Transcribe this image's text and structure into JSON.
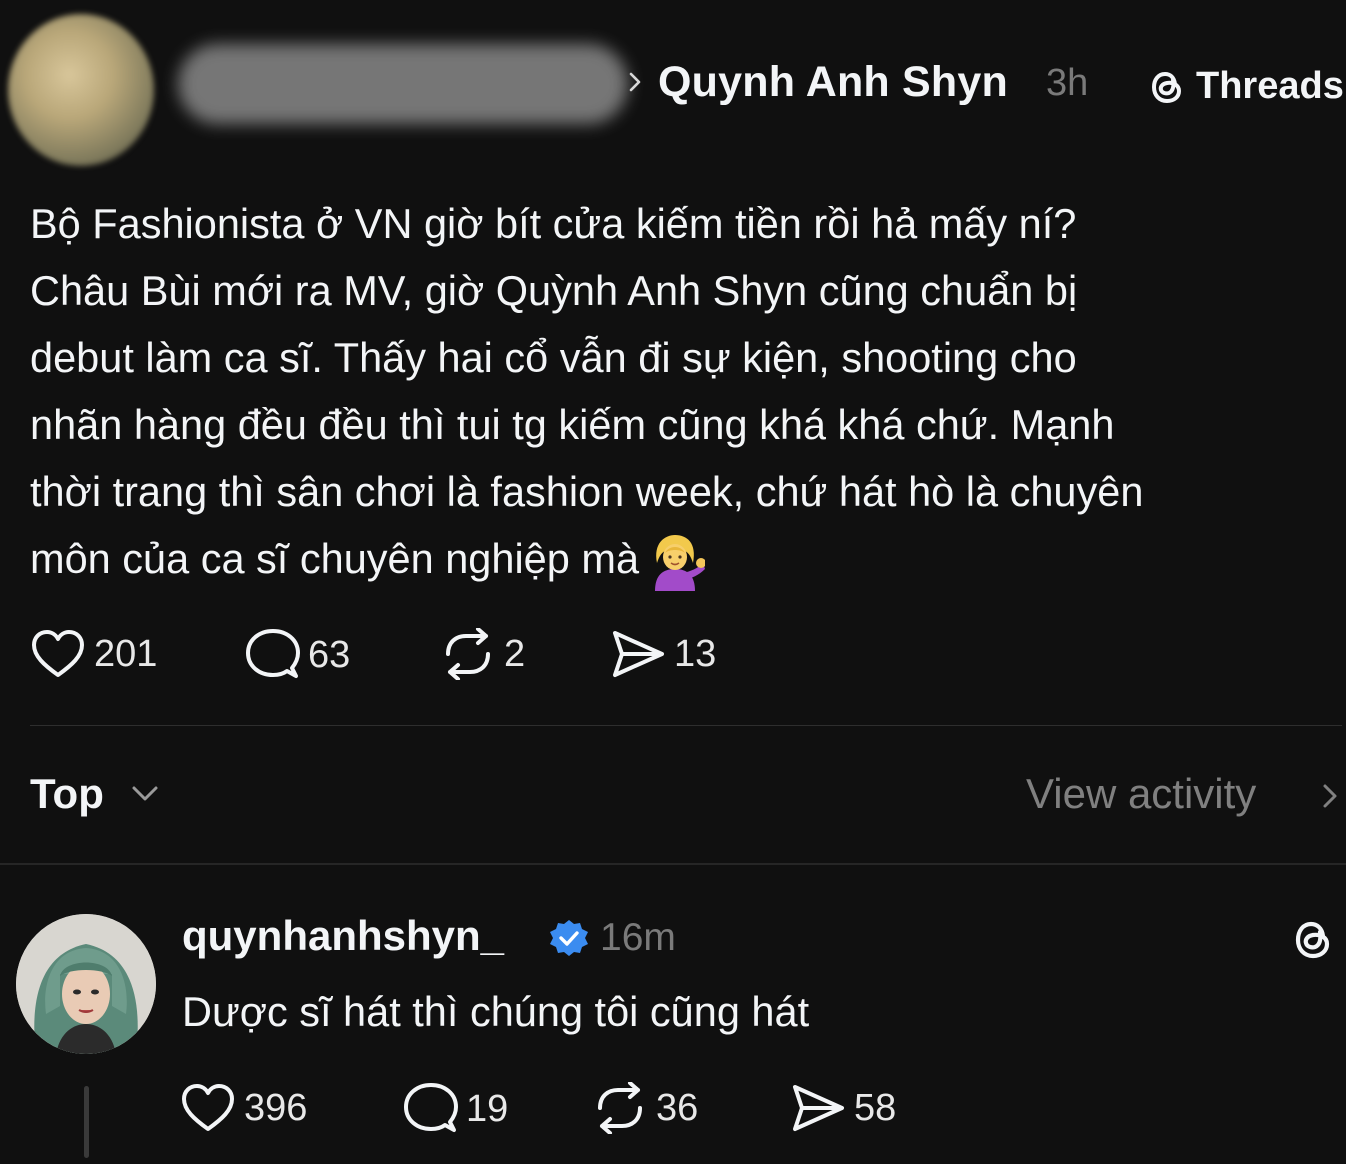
{
  "post": {
    "author": "Quynh Anh Shyn",
    "time": "3h",
    "threads_label": "Threads",
    "body_lines": [
      "Bộ Fashionista ở VN giờ bít cửa kiếm tiền rồi hả mấy ní?",
      "Châu Bùi mới ra MV, giờ Quỳnh Anh Shyn cũng chuẩn bị",
      "debut làm ca sĩ. Thấy hai cổ vẫn đi sự kiện, shooting cho",
      "nhãn hàng đều đều thì tui tg kiếm cũng khá khá chứ. Mạnh",
      "thời trang thì sân chơi là fashion week, chứ hát hò là chuyên",
      "môn của ca sĩ chuyên nghiệp mà"
    ],
    "likes": "201",
    "replies": "63",
    "reposts": "2",
    "shares": "13"
  },
  "sort": {
    "label": "Top",
    "view_activity": "View activity"
  },
  "reply": {
    "username": "quynhanhshyn_",
    "time": "16m",
    "text": "Dược sĩ hát thì chúng tôi cũng hát",
    "likes": "396",
    "replies": "19",
    "reposts": "36",
    "shares": "58"
  },
  "icons": {
    "like": "heart-icon",
    "reply": "speech-bubble-icon",
    "repost": "repost-icon",
    "share": "send-icon",
    "threads": "threads-logo-icon",
    "verified": "verified-badge-icon",
    "emoji": "person-tipping-hand-emoji"
  },
  "colors": {
    "background": "#101010",
    "text": "#f3f5f7",
    "muted": "#7a7a7a",
    "verified": "#3b8cf0"
  }
}
